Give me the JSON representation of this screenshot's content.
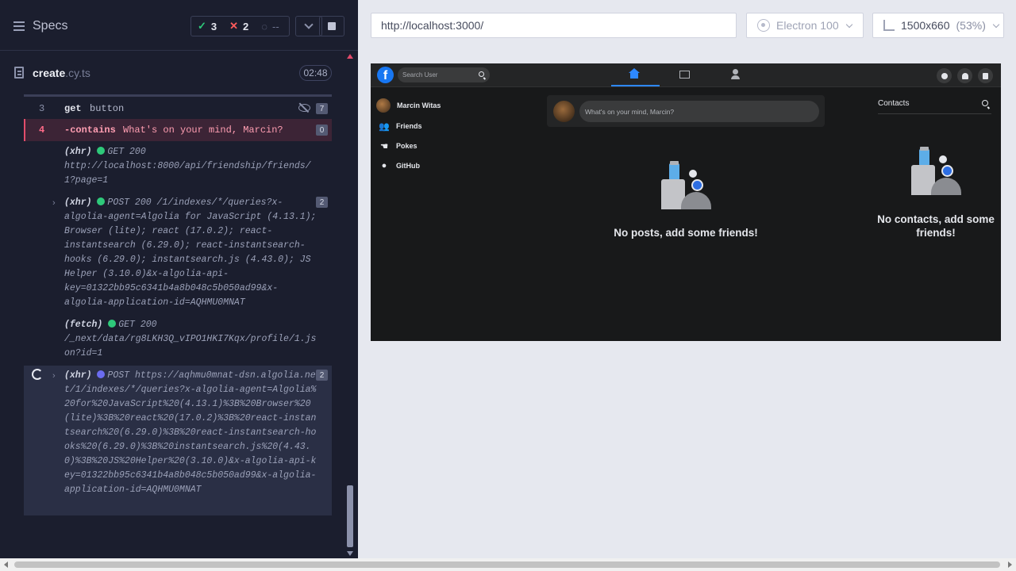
{
  "reporter": {
    "title": "Specs",
    "stats": {
      "passed": "3",
      "failed": "2",
      "pending": "--"
    },
    "spec": {
      "name": "create",
      "ext": ".cy.ts",
      "duration": "02:48"
    },
    "commands": [
      {
        "number": "3",
        "name": "get",
        "message": "button",
        "count": "7"
      },
      {
        "number": "4",
        "name": "-contains",
        "message": "What's on your mind, Marcin?",
        "count": "0"
      }
    ],
    "logs": [
      {
        "kind": "(xhr)",
        "status": "GET 200",
        "text": "http://localhost:8000/api/friendship/friends/1?page=1"
      },
      {
        "kind": "(xhr)",
        "status": "POST 200",
        "text": "/1/indexes/*/queries?x-algolia-agent=Algolia for JavaScript (4.13.1); Browser (lite); react (17.0.2); react-instantsearch (6.29.0); react-instantsearch-hooks (6.29.0); instantsearch.js (4.43.0); JS Helper (3.10.0)&x-algolia-api-key=01322bb95c6341b4a8b048c5b050ad99&x-algolia-application-id=AQHMU0MNAT",
        "count": "2"
      },
      {
        "kind": "(fetch)",
        "status": "GET 200",
        "text": "/_next/data/rg8LKH3Q_vIPO1HKI7Kqx/profile/1.json?id=1"
      },
      {
        "kind": "(xhr)",
        "status": "POST",
        "text": "https://aqhmu0mnat-dsn.algolia.net/1/indexes/*/queries?x-algolia-agent=Algolia%20for%20JavaScript%20(4.13.1)%3B%20Browser%20(lite)%3B%20react%20(17.0.2)%3B%20react-instantsearch%20(6.29.0)%3B%20react-instantsearch-hooks%20(6.29.0)%3B%20instantsearch.js%20(4.43.0)%3B%20JS%20Helper%20(3.10.0)&x-algolia-api-key=01322bb95c6341b4a8b048c5b050ad99&x-algolia-application-id=AQHMU0MNAT",
        "count": "2"
      }
    ]
  },
  "toolbar": {
    "url": "http://localhost:3000/",
    "browser": "Electron 100",
    "viewport": "1500x660",
    "scale": "(53%)"
  },
  "app": {
    "search_placeholder": "Search User",
    "user_name": "Marcin Witas",
    "side_menu": [
      "Friends",
      "Pokes",
      "GitHub"
    ],
    "composer_placeholder": "What's on your mind, Marcin?",
    "no_posts": "No posts, add some friends!",
    "contacts_title": "Contacts",
    "no_contacts": "No contacts, add some friends!"
  },
  "colors": {
    "reporter_bg": "#1b1e2e",
    "failed_accent": "#e34d6b",
    "passed": "#2ec97a",
    "facebook_blue": "#1877f2",
    "app_bg": "#18191a"
  }
}
